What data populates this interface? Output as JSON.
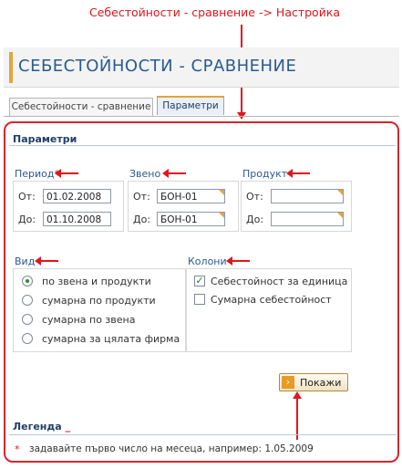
{
  "annotation": {
    "top_caption": "Себестойности - сравнение -> Настройка"
  },
  "header": {
    "title": "СЕБЕСТОЙНОСТИ - СРАВНЕНИЕ"
  },
  "tabs": [
    {
      "label": "Себестойности - сравнение",
      "active": false
    },
    {
      "label": "Параметри",
      "active": true
    }
  ],
  "params": {
    "section_title": "Параметри",
    "period": {
      "label": "Период",
      "required_mark": "*",
      "from_label": "От:",
      "to_label": "До:",
      "from_value": "01.02.2008",
      "to_value": "01.10.2008"
    },
    "zveno": {
      "label": "Звено",
      "from_label": "От:",
      "to_label": "До:",
      "from_value": "БОН-01",
      "to_value": "БОН-01"
    },
    "product": {
      "label": "Продукт",
      "from_label": "От:",
      "to_label": "До:",
      "from_value": "",
      "to_value": ""
    },
    "vid": {
      "label": "Вид",
      "options": [
        {
          "label": "по звена и продукти",
          "selected": true
        },
        {
          "label": "сумарна по продукти",
          "selected": false
        },
        {
          "label": "сумарна по звена",
          "selected": false
        },
        {
          "label": "сумарна за цялата фирма",
          "selected": false
        }
      ]
    },
    "columns": {
      "label": "Колони",
      "options": [
        {
          "label": "Себестойност за единица",
          "checked": true
        },
        {
          "label": "Сумарна себестойност",
          "checked": false
        }
      ]
    },
    "show_button": "Покажи"
  },
  "legend": {
    "title": "Легенда",
    "title_suffix": "_",
    "star": "*",
    "note": "задавайте първо число на месеца, например: 1.05.2009"
  },
  "colors": {
    "accent": "#e0161b",
    "title": "#2a5b8f",
    "tab_accent": "#e2a63b"
  }
}
